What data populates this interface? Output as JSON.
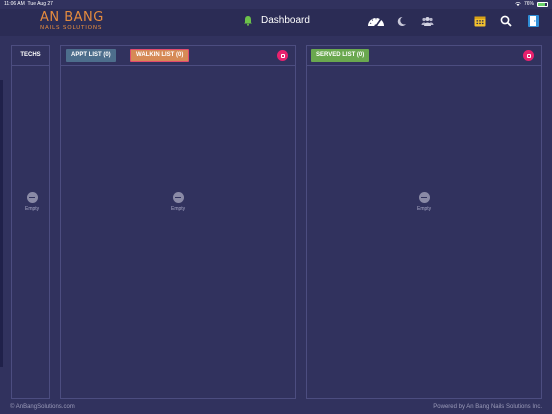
{
  "statusbar": {
    "time": "11:06 AM",
    "date": "Tue Aug 27",
    "battery": "76%",
    "battery_level": 0.76
  },
  "header": {
    "logo_main": "AN BANG",
    "logo_sub": "NAILS SOLUTIONS",
    "title": "Dashboard",
    "icons": [
      "bell-icon",
      "speedometer-icon",
      "moon-icon",
      "group-icon",
      "calendar-icon",
      "search-icon",
      "exit-icon"
    ]
  },
  "techs_panel": {
    "label": "TECHS",
    "empty_label": "Empty"
  },
  "appt_panel": {
    "appt_tab": "APPT LIST (0)",
    "walkin_tab": "WALKIN LIST (0)",
    "empty_label": "Empty"
  },
  "served_panel": {
    "served_tab": "SERVED LIST (0)",
    "empty_label": "Empty"
  },
  "footer": {
    "left": "© AnBangSolutions.com",
    "right": "Powered by An Bang Nails Solutions Inc."
  },
  "colors": {
    "background": "#31325e",
    "header": "#2b2c55",
    "accent_logo": "#e58b3e",
    "close_button": "#e8216e",
    "served_tab": "#6aa84f",
    "appt_tab": "#4d6e8c",
    "walkin_tab": "#d68a56"
  }
}
